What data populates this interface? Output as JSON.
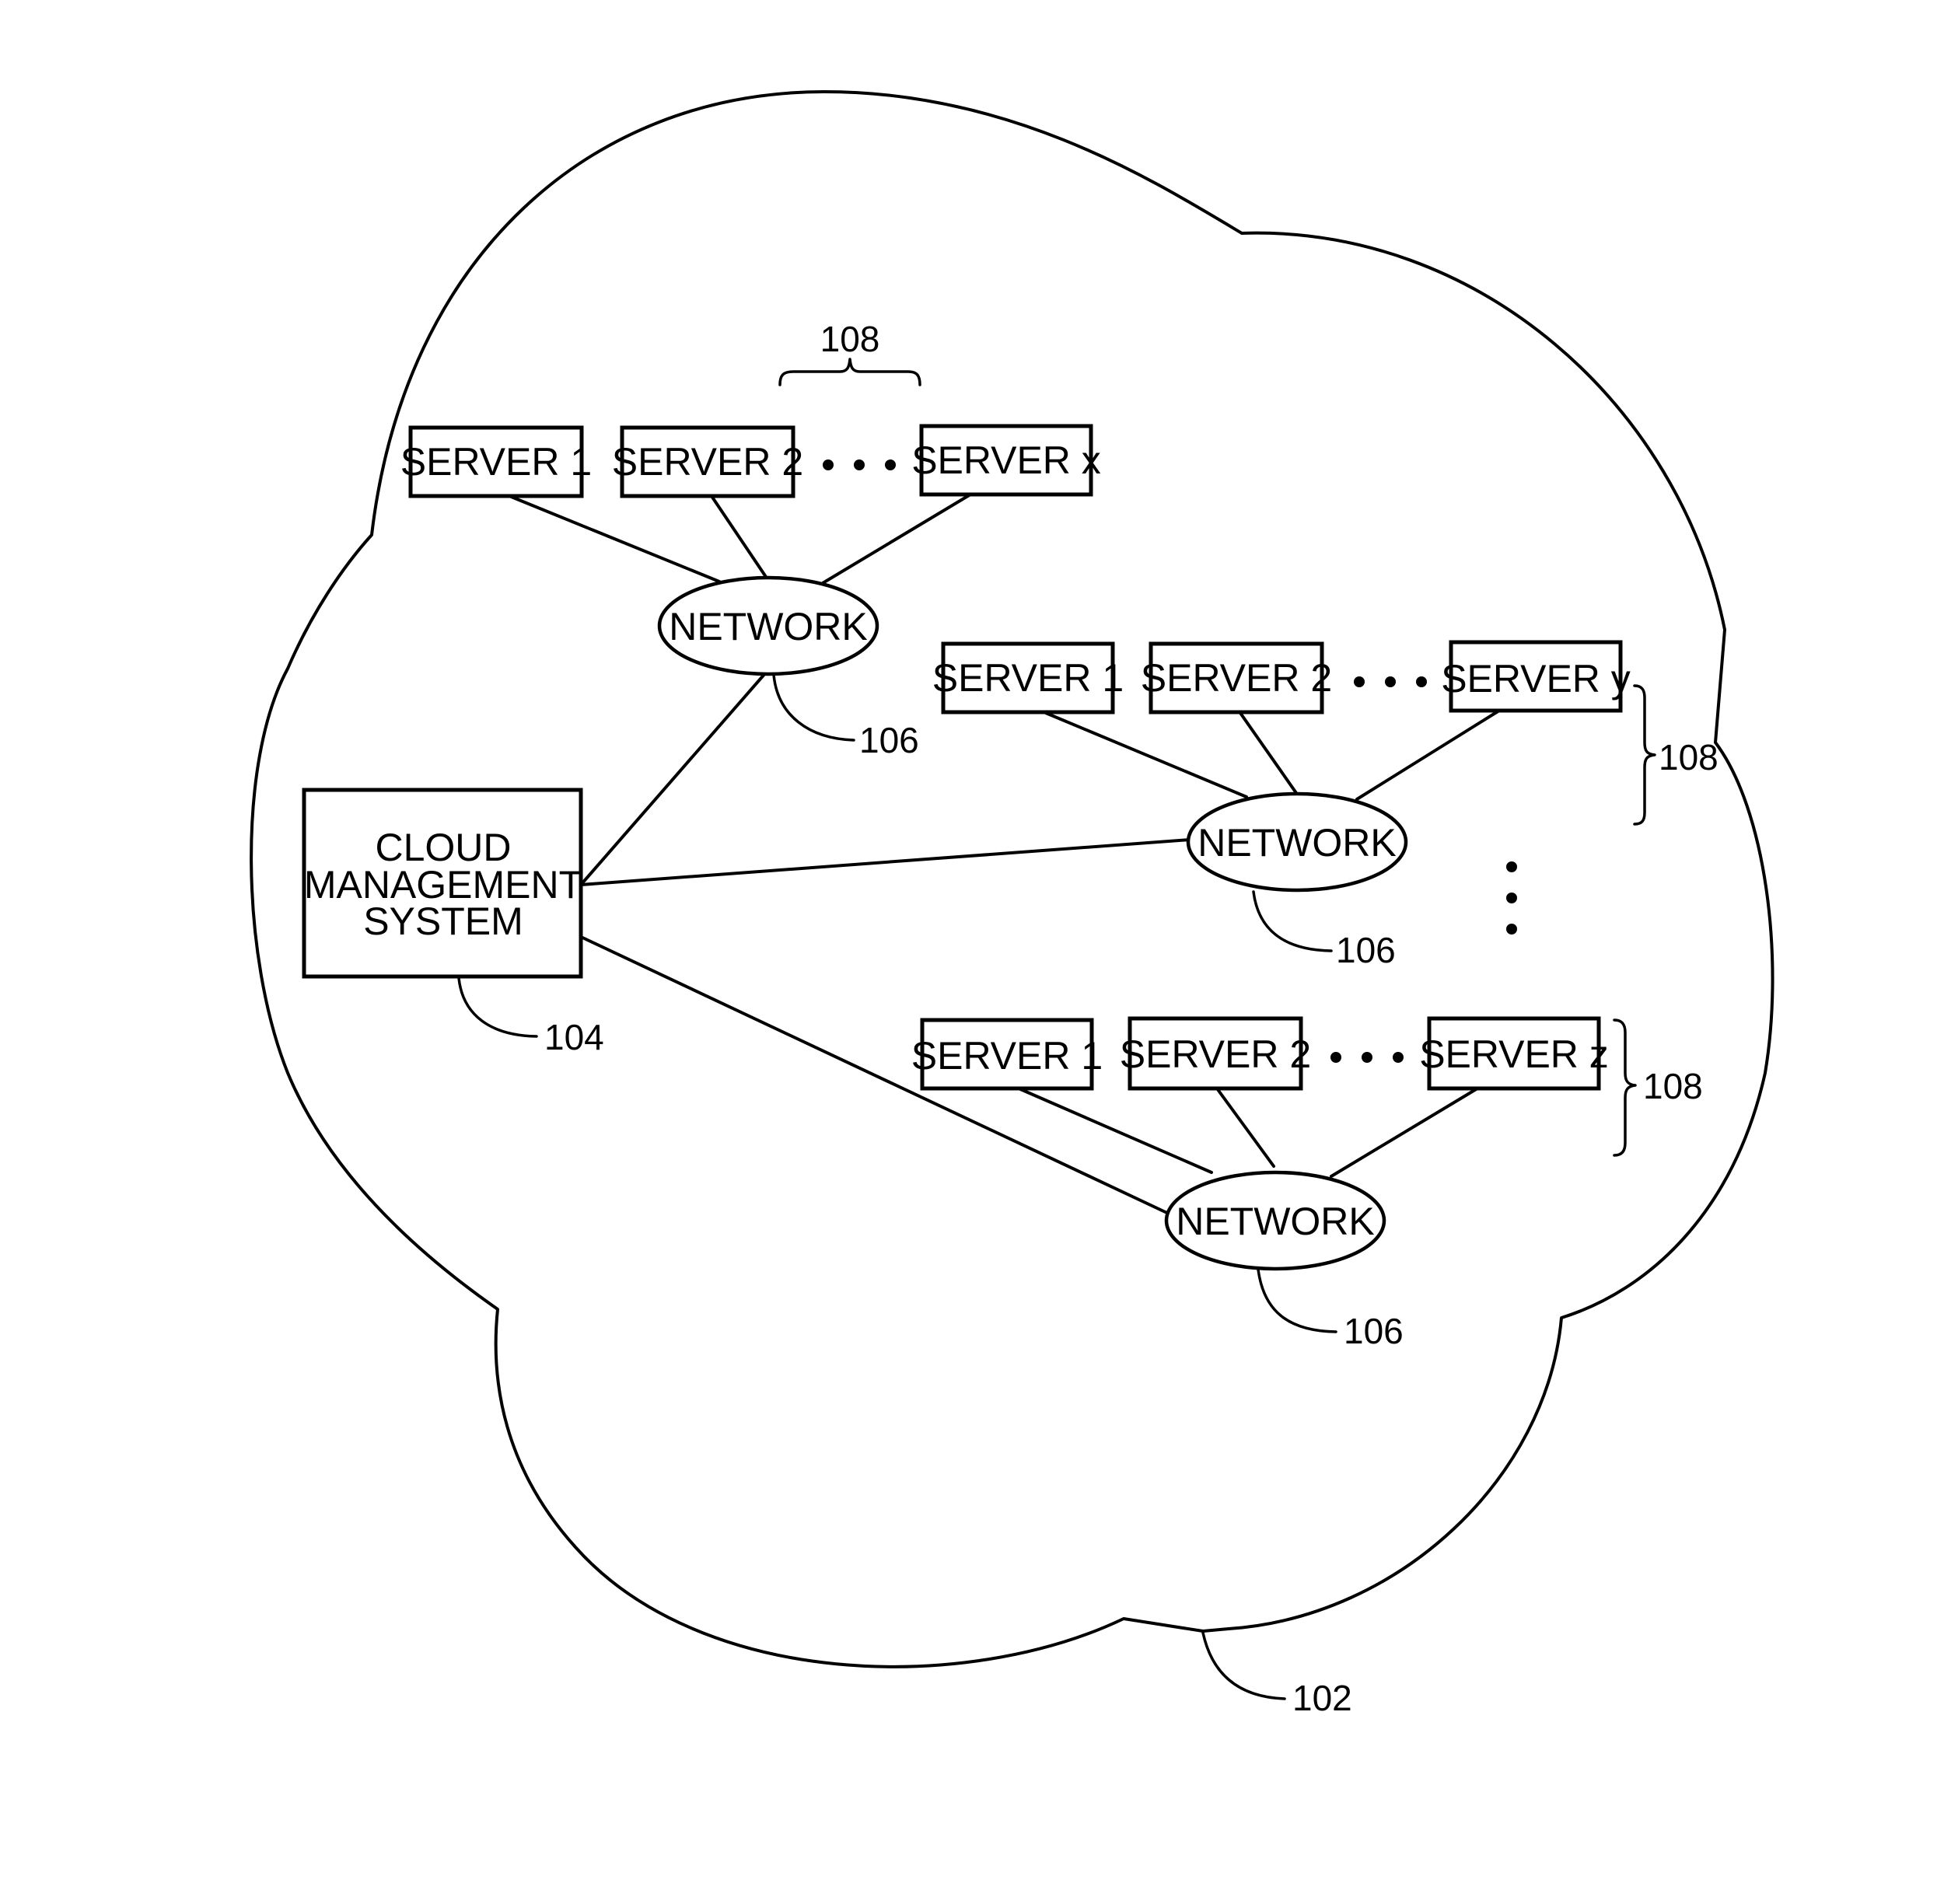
{
  "figure": {
    "cloud": {
      "ref": "102"
    },
    "cloud_management_system": {
      "lines": [
        "CLOUD",
        "MANAGEMENT",
        "SYSTEM"
      ],
      "ref": "104"
    },
    "network_ref": "106",
    "server_group_ref": "108",
    "ellipsis": "• • •",
    "groups": [
      {
        "network_label": "NETWORK",
        "network_ref": "106",
        "group_ref": "108",
        "servers": [
          "SERVER 1",
          "SERVER 2",
          "SERVER x"
        ]
      },
      {
        "network_label": "NETWORK",
        "network_ref": "106",
        "group_ref": "108",
        "servers": [
          "SERVER 1",
          "SERVER 2",
          "SERVER y"
        ]
      },
      {
        "network_label": "NETWORK",
        "network_ref": "106",
        "group_ref": "108",
        "servers": [
          "SERVER 1",
          "SERVER 2",
          "SERVER z"
        ]
      }
    ]
  }
}
